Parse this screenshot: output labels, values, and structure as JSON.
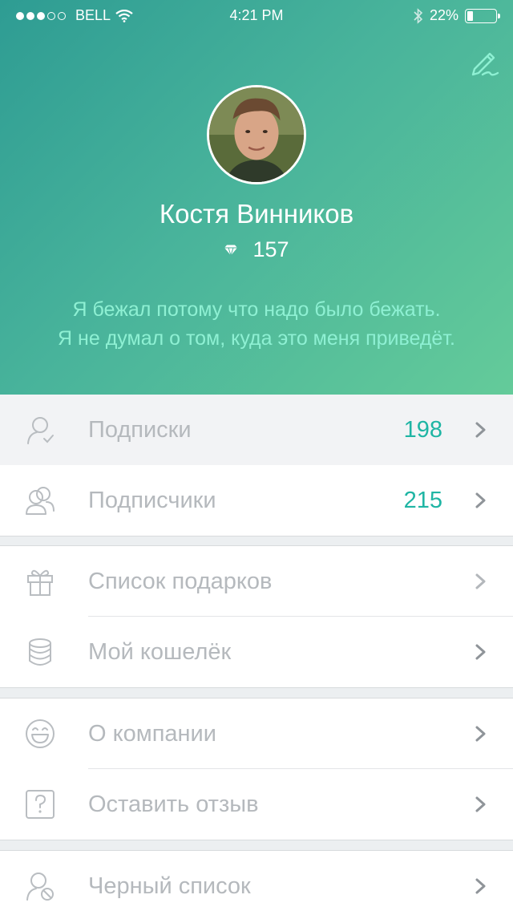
{
  "status_bar": {
    "carrier": "BELL",
    "time": "4:21 PM",
    "battery": "22%",
    "battery_level": 0.22,
    "signal_bars_filled": 3,
    "signal_bars_total": 5
  },
  "profile": {
    "name": "Костя Винников",
    "score": "157",
    "quote_line1": "Я бежал потому что надо было бежать.",
    "quote_line2": "Я не думал о том, куда это меня приведёт."
  },
  "colors": {
    "gradient_start": "#2e9c93",
    "gradient_end": "#64cb9a",
    "accent": "#1fb5a4",
    "quote": "#8ef0d3",
    "menu_text": "#b5b9bd"
  },
  "menu": {
    "subscriptions": {
      "label": "Подписки",
      "count": "198",
      "icon": "user-check-icon"
    },
    "subscribers": {
      "label": "Подписчики",
      "count": "215",
      "icon": "users-icon"
    },
    "gift_list": {
      "label": "Список подарков",
      "icon": "gift-icon"
    },
    "wallet": {
      "label": "Мой кошелёк",
      "icon": "coins-icon"
    },
    "about": {
      "label": "О компании",
      "icon": "smile-icon"
    },
    "feedback": {
      "label": "Оставить отзыв",
      "icon": "question-icon"
    },
    "blacklist": {
      "label": "Черный список",
      "icon": "user-blocked-icon"
    }
  }
}
